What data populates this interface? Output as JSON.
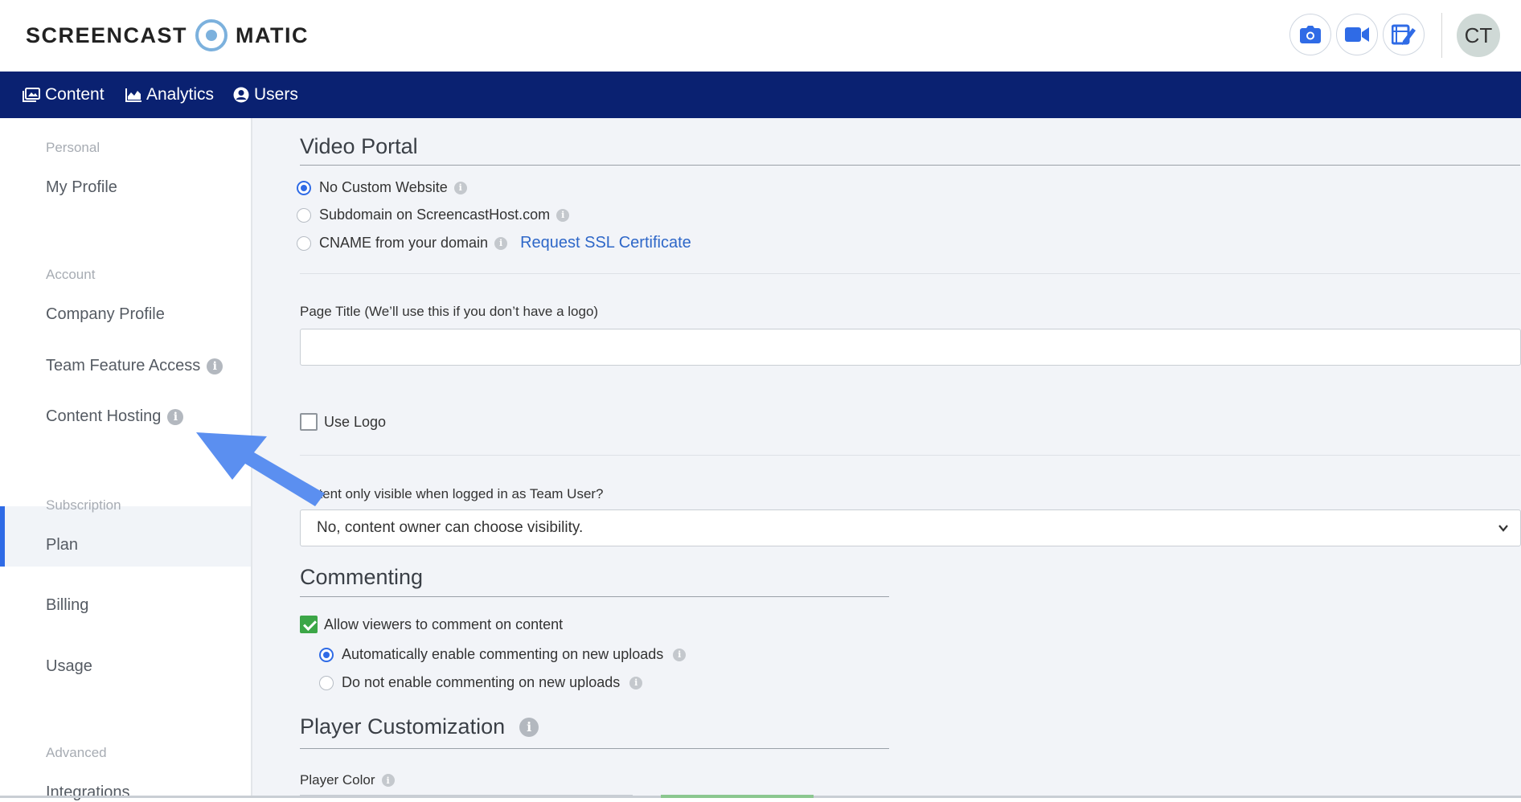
{
  "header": {
    "logo_left": "SCREENCAST",
    "logo_right": "MATIC",
    "tools": [
      {
        "name": "screenshot",
        "icon": "camera-icon"
      },
      {
        "name": "record",
        "icon": "video-camera-icon"
      },
      {
        "name": "edit",
        "icon": "video-edit-icon"
      }
    ],
    "avatar_initials": "CT"
  },
  "nav": {
    "items": [
      {
        "label": "Content",
        "icon": "content-icon"
      },
      {
        "label": "Analytics",
        "icon": "analytics-icon"
      },
      {
        "label": "Users",
        "icon": "user-circle-icon"
      }
    ]
  },
  "sidebar": {
    "sections": [
      {
        "heading": "Personal",
        "items": [
          "My Profile"
        ]
      },
      {
        "heading": "Account",
        "items": [
          "Company Profile",
          "Team Feature Access",
          "Content Hosting"
        ]
      },
      {
        "heading": "Subscription",
        "items": [
          "Plan",
          "Billing",
          "Usage"
        ]
      },
      {
        "heading": "Advanced",
        "items": [
          "Integrations"
        ]
      }
    ],
    "active_item": "Content Hosting"
  },
  "main": {
    "video_portal": {
      "title": "Video Portal",
      "options": [
        {
          "label": "No Custom Website",
          "selected": true
        },
        {
          "label": "Subdomain on ScreencastHost.com",
          "selected": false
        },
        {
          "label": "CNAME from your domain",
          "selected": false
        }
      ],
      "ssl_link": "Request SSL Certificate"
    },
    "page_title": {
      "label": "Page Title (We’ll use this if you don’t have a logo)",
      "value": ""
    },
    "use_logo": {
      "label": "Use Logo",
      "checked": false
    },
    "visibility": {
      "label": "ntent only visible when logged in as Team User?",
      "selected": "No, content owner can choose visibility."
    },
    "commenting": {
      "title": "Commenting",
      "allow_label": "Allow viewers to comment on content",
      "allow_checked": true,
      "options": [
        {
          "label": "Automatically enable commenting on new uploads",
          "selected": true
        },
        {
          "label": "Do not enable commenting on new uploads",
          "selected": false
        }
      ]
    },
    "player": {
      "title": "Player Customization",
      "color_label": "Player Color"
    }
  },
  "colors": {
    "nav_bg": "#0a2171",
    "accent": "#2f6be6",
    "check_green": "#3ca647",
    "arrow": "#5b8ff0"
  }
}
